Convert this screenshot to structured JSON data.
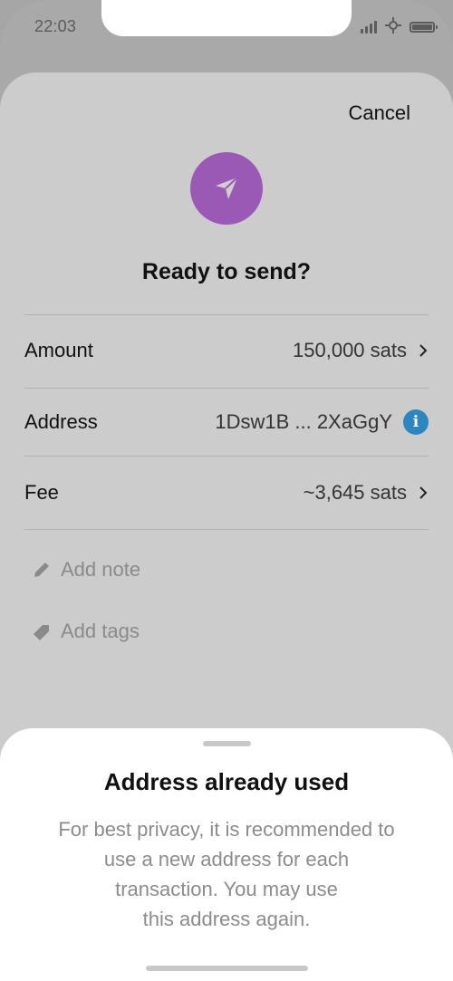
{
  "status_bar": {
    "time": "22:03"
  },
  "header": {
    "cancel_label": "Cancel"
  },
  "main": {
    "icon": "send-icon",
    "accent_color": "#9b59b6",
    "title": "Ready to send?",
    "rows": [
      {
        "label": "Amount",
        "value": "150,000 sats"
      },
      {
        "label": "Address",
        "value": "1Dsw1B ... 2XaGgY"
      },
      {
        "label": "Fee",
        "value": "~3,645 sats"
      }
    ],
    "actions": [
      {
        "label": "Add note",
        "icon": "pencil-icon"
      },
      {
        "label": "Add tags",
        "icon": "tag-icon"
      }
    ]
  },
  "sheet": {
    "title": "Address already used",
    "body_lines": [
      "For best privacy, it is recommended to",
      "use a new address for each",
      "transaction. You may use",
      "this address again."
    ]
  },
  "colors": {
    "info": "#2e86c1"
  }
}
